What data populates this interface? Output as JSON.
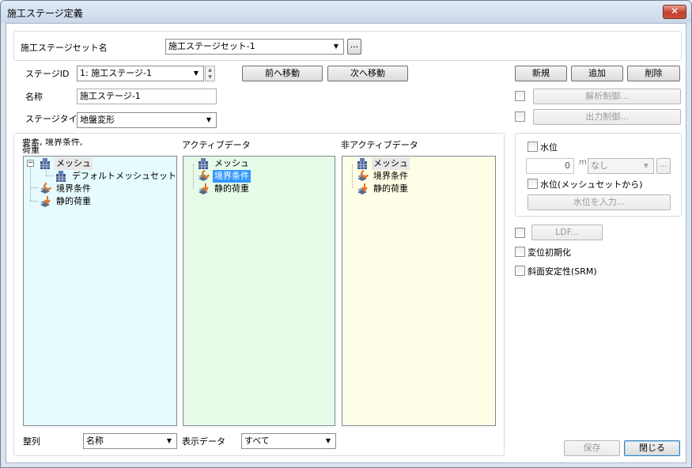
{
  "window": {
    "title": "施工ステージ定義",
    "close_glyph": "✕"
  },
  "stage_set": {
    "label": "施工ステージセット名",
    "value": "施工ステージセット-1",
    "browse_label": "..."
  },
  "stage": {
    "id_label": "ステージID",
    "id_value": "1: 施工ステージ-1",
    "prev_label": "前へ移動",
    "next_label": "次へ移動",
    "name_label": "名称",
    "name_value": "施工ステージ-1",
    "type_label": "ステージタイプ",
    "type_value": "地盤変形"
  },
  "actions": {
    "new_label": "新規",
    "add_label": "追加",
    "delete_label": "削除"
  },
  "controls": {
    "analysis_label": "解析制御...",
    "output_label": "出力制御..."
  },
  "lists": {
    "elements_label": "要素, 境界条件, 荷重",
    "active_label": "アクティブデータ",
    "inactive_label": "非アクティブデータ",
    "elements_tree": {
      "mesh": "メッシュ",
      "default_mesh_set": "デフォルトメッシュセット",
      "boundary": "境界条件",
      "static_load": "静的荷重"
    },
    "active_tree": {
      "mesh": "メッシュ",
      "boundary": "境界条件",
      "static_load": "静的荷重"
    },
    "inactive_tree": {
      "mesh": "メッシュ",
      "boundary": "境界条件",
      "static_load": "静的荷重"
    }
  },
  "water": {
    "checkbox_label": "水位",
    "level_value": "0",
    "unit": "m",
    "function_value": "なし",
    "browse_label": "...",
    "from_mesh_label": "水位(メッシュセットから)",
    "input_label": "水位を入力..."
  },
  "options": {
    "ldf_label": "LDF...",
    "disp_init_label": "変位初期化",
    "srm_label": "斜面安定性(SRM)"
  },
  "bottom": {
    "sort_label": "整列",
    "sort_value": "名称",
    "display_label": "表示データ",
    "display_value": "すべて",
    "save_label": "保存",
    "close_label": "閉じる"
  },
  "colors": {
    "elements_bg": "#e5fbfd",
    "active_bg": "#e6fbe8",
    "inactive_bg": "#fefde6",
    "selection": "#3399ff"
  }
}
